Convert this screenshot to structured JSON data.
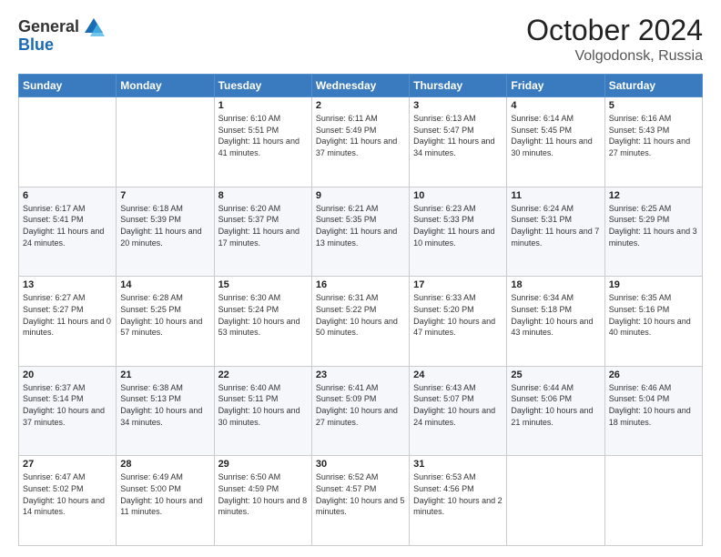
{
  "header": {
    "logo_general": "General",
    "logo_blue": "Blue",
    "month": "October 2024",
    "location": "Volgodonsk, Russia"
  },
  "weekdays": [
    "Sunday",
    "Monday",
    "Tuesday",
    "Wednesday",
    "Thursday",
    "Friday",
    "Saturday"
  ],
  "weeks": [
    [
      {
        "day": "",
        "sunrise": "",
        "sunset": "",
        "daylight": ""
      },
      {
        "day": "",
        "sunrise": "",
        "sunset": "",
        "daylight": ""
      },
      {
        "day": "1",
        "sunrise": "Sunrise: 6:10 AM",
        "sunset": "Sunset: 5:51 PM",
        "daylight": "Daylight: 11 hours and 41 minutes."
      },
      {
        "day": "2",
        "sunrise": "Sunrise: 6:11 AM",
        "sunset": "Sunset: 5:49 PM",
        "daylight": "Daylight: 11 hours and 37 minutes."
      },
      {
        "day": "3",
        "sunrise": "Sunrise: 6:13 AM",
        "sunset": "Sunset: 5:47 PM",
        "daylight": "Daylight: 11 hours and 34 minutes."
      },
      {
        "day": "4",
        "sunrise": "Sunrise: 6:14 AM",
        "sunset": "Sunset: 5:45 PM",
        "daylight": "Daylight: 11 hours and 30 minutes."
      },
      {
        "day": "5",
        "sunrise": "Sunrise: 6:16 AM",
        "sunset": "Sunset: 5:43 PM",
        "daylight": "Daylight: 11 hours and 27 minutes."
      }
    ],
    [
      {
        "day": "6",
        "sunrise": "Sunrise: 6:17 AM",
        "sunset": "Sunset: 5:41 PM",
        "daylight": "Daylight: 11 hours and 24 minutes."
      },
      {
        "day": "7",
        "sunrise": "Sunrise: 6:18 AM",
        "sunset": "Sunset: 5:39 PM",
        "daylight": "Daylight: 11 hours and 20 minutes."
      },
      {
        "day": "8",
        "sunrise": "Sunrise: 6:20 AM",
        "sunset": "Sunset: 5:37 PM",
        "daylight": "Daylight: 11 hours and 17 minutes."
      },
      {
        "day": "9",
        "sunrise": "Sunrise: 6:21 AM",
        "sunset": "Sunset: 5:35 PM",
        "daylight": "Daylight: 11 hours and 13 minutes."
      },
      {
        "day": "10",
        "sunrise": "Sunrise: 6:23 AM",
        "sunset": "Sunset: 5:33 PM",
        "daylight": "Daylight: 11 hours and 10 minutes."
      },
      {
        "day": "11",
        "sunrise": "Sunrise: 6:24 AM",
        "sunset": "Sunset: 5:31 PM",
        "daylight": "Daylight: 11 hours and 7 minutes."
      },
      {
        "day": "12",
        "sunrise": "Sunrise: 6:25 AM",
        "sunset": "Sunset: 5:29 PM",
        "daylight": "Daylight: 11 hours and 3 minutes."
      }
    ],
    [
      {
        "day": "13",
        "sunrise": "Sunrise: 6:27 AM",
        "sunset": "Sunset: 5:27 PM",
        "daylight": "Daylight: 11 hours and 0 minutes."
      },
      {
        "day": "14",
        "sunrise": "Sunrise: 6:28 AM",
        "sunset": "Sunset: 5:25 PM",
        "daylight": "Daylight: 10 hours and 57 minutes."
      },
      {
        "day": "15",
        "sunrise": "Sunrise: 6:30 AM",
        "sunset": "Sunset: 5:24 PM",
        "daylight": "Daylight: 10 hours and 53 minutes."
      },
      {
        "day": "16",
        "sunrise": "Sunrise: 6:31 AM",
        "sunset": "Sunset: 5:22 PM",
        "daylight": "Daylight: 10 hours and 50 minutes."
      },
      {
        "day": "17",
        "sunrise": "Sunrise: 6:33 AM",
        "sunset": "Sunset: 5:20 PM",
        "daylight": "Daylight: 10 hours and 47 minutes."
      },
      {
        "day": "18",
        "sunrise": "Sunrise: 6:34 AM",
        "sunset": "Sunset: 5:18 PM",
        "daylight": "Daylight: 10 hours and 43 minutes."
      },
      {
        "day": "19",
        "sunrise": "Sunrise: 6:35 AM",
        "sunset": "Sunset: 5:16 PM",
        "daylight": "Daylight: 10 hours and 40 minutes."
      }
    ],
    [
      {
        "day": "20",
        "sunrise": "Sunrise: 6:37 AM",
        "sunset": "Sunset: 5:14 PM",
        "daylight": "Daylight: 10 hours and 37 minutes."
      },
      {
        "day": "21",
        "sunrise": "Sunrise: 6:38 AM",
        "sunset": "Sunset: 5:13 PM",
        "daylight": "Daylight: 10 hours and 34 minutes."
      },
      {
        "day": "22",
        "sunrise": "Sunrise: 6:40 AM",
        "sunset": "Sunset: 5:11 PM",
        "daylight": "Daylight: 10 hours and 30 minutes."
      },
      {
        "day": "23",
        "sunrise": "Sunrise: 6:41 AM",
        "sunset": "Sunset: 5:09 PM",
        "daylight": "Daylight: 10 hours and 27 minutes."
      },
      {
        "day": "24",
        "sunrise": "Sunrise: 6:43 AM",
        "sunset": "Sunset: 5:07 PM",
        "daylight": "Daylight: 10 hours and 24 minutes."
      },
      {
        "day": "25",
        "sunrise": "Sunrise: 6:44 AM",
        "sunset": "Sunset: 5:06 PM",
        "daylight": "Daylight: 10 hours and 21 minutes."
      },
      {
        "day": "26",
        "sunrise": "Sunrise: 6:46 AM",
        "sunset": "Sunset: 5:04 PM",
        "daylight": "Daylight: 10 hours and 18 minutes."
      }
    ],
    [
      {
        "day": "27",
        "sunrise": "Sunrise: 6:47 AM",
        "sunset": "Sunset: 5:02 PM",
        "daylight": "Daylight: 10 hours and 14 minutes."
      },
      {
        "day": "28",
        "sunrise": "Sunrise: 6:49 AM",
        "sunset": "Sunset: 5:00 PM",
        "daylight": "Daylight: 10 hours and 11 minutes."
      },
      {
        "day": "29",
        "sunrise": "Sunrise: 6:50 AM",
        "sunset": "Sunset: 4:59 PM",
        "daylight": "Daylight: 10 hours and 8 minutes."
      },
      {
        "day": "30",
        "sunrise": "Sunrise: 6:52 AM",
        "sunset": "Sunset: 4:57 PM",
        "daylight": "Daylight: 10 hours and 5 minutes."
      },
      {
        "day": "31",
        "sunrise": "Sunrise: 6:53 AM",
        "sunset": "Sunset: 4:56 PM",
        "daylight": "Daylight: 10 hours and 2 minutes."
      },
      {
        "day": "",
        "sunrise": "",
        "sunset": "",
        "daylight": ""
      },
      {
        "day": "",
        "sunrise": "",
        "sunset": "",
        "daylight": ""
      }
    ]
  ]
}
